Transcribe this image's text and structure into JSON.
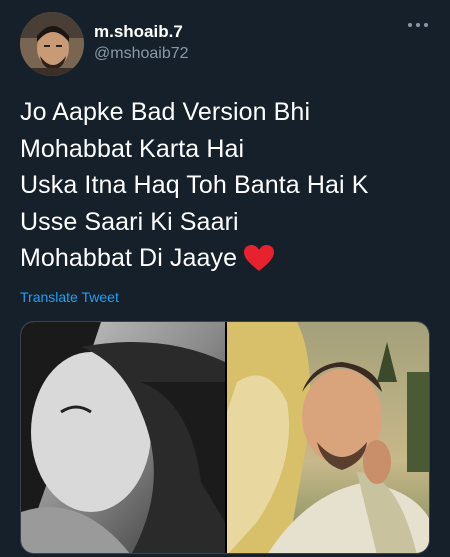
{
  "user": {
    "display_name": "m.shoaib.7",
    "handle": "@mshoaib72"
  },
  "icons": {
    "more": "more-horizontal-icon",
    "heart": "red-heart-emoji"
  },
  "tweet": {
    "lines": [
      "Jo Aapke Bad Version Bhi",
      "Mohabbat Karta Hai",
      "Uska Itna Haq Toh Banta Hai K",
      "Usse Saari Ki Saari",
      "Mohabbat Di Jaaye"
    ]
  },
  "translate_label": "Translate Tweet",
  "colors": {
    "background": "#15202b",
    "text": "#ffffff",
    "secondary": "#8899a6",
    "link": "#1da1f2",
    "heart": "#e8212e"
  }
}
